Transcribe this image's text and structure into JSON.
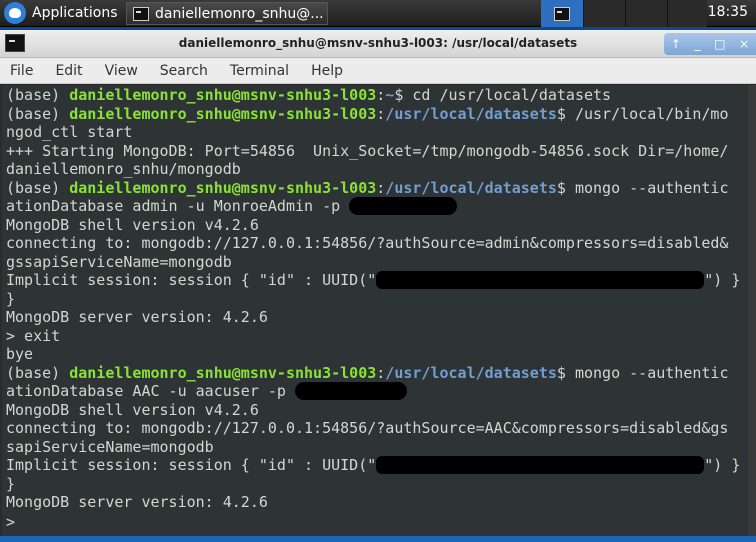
{
  "taskbar": {
    "apps_label": "Applications",
    "task_label": "daniellemonro_snhu@...",
    "clock": "18:35"
  },
  "window": {
    "title": "daniellemonro_snhu@msnv-snhu3-l003: /usr/local/datasets",
    "controls": [
      "↑",
      "_",
      "□",
      "×"
    ]
  },
  "menu": [
    "File",
    "Edit",
    "View",
    "Search",
    "Terminal",
    "Help"
  ],
  "prompt": {
    "env": "(base) ",
    "user": "daniellemonro_snhu@msnv-snhu3-l003",
    "home_path": "~",
    "datasets_path": "/usr/local/datasets"
  },
  "terminal": {
    "l1_cmd": "$ cd /usr/local/datasets",
    "l2_cmd": "$ /usr/local/bin/mo",
    "l3": "ngod_ctl start",
    "l4": "+++ Starting MongoDB: Port=54856  Unix_Socket=/tmp/mongodb-54856.sock Dir=/home/",
    "l5": "daniellemonro_snhu/mongodb",
    "l6_cmd": "$ mongo --authentic",
    "l7": "ationDatabase admin -u MonroeAdmin -p ",
    "l8": "MongoDB shell version v4.2.6",
    "l9": "connecting to: mongodb://127.0.0.1:54856/?authSource=admin&compressors=disabled&",
    "l10": "gssapiServiceName=mongodb",
    "l11_a": "Implicit session: session { \"id\" : UUID(\"",
    "l11_b": "\") }",
    "l12": "}",
    "l13": "MongoDB server version: 4.2.6",
    "l14": "> exit",
    "l15": "bye",
    "l16_cmd": "$ mongo --authentic",
    "l17": "ationDatabase AAC -u aacuser -p ",
    "l18": "MongoDB shell version v4.2.6",
    "l19": "connecting to: mongodb://127.0.0.1:54856/?authSource=AAC&compressors=disabled&gs",
    "l20": "sapiServiceName=mongodb",
    "l21_a": "Implicit session: session { \"id\" : UUID(\"",
    "l21_b": "\") }",
    "l22": "}",
    "l23": "MongoDB server version: 4.2.6",
    "l24": ">"
  }
}
